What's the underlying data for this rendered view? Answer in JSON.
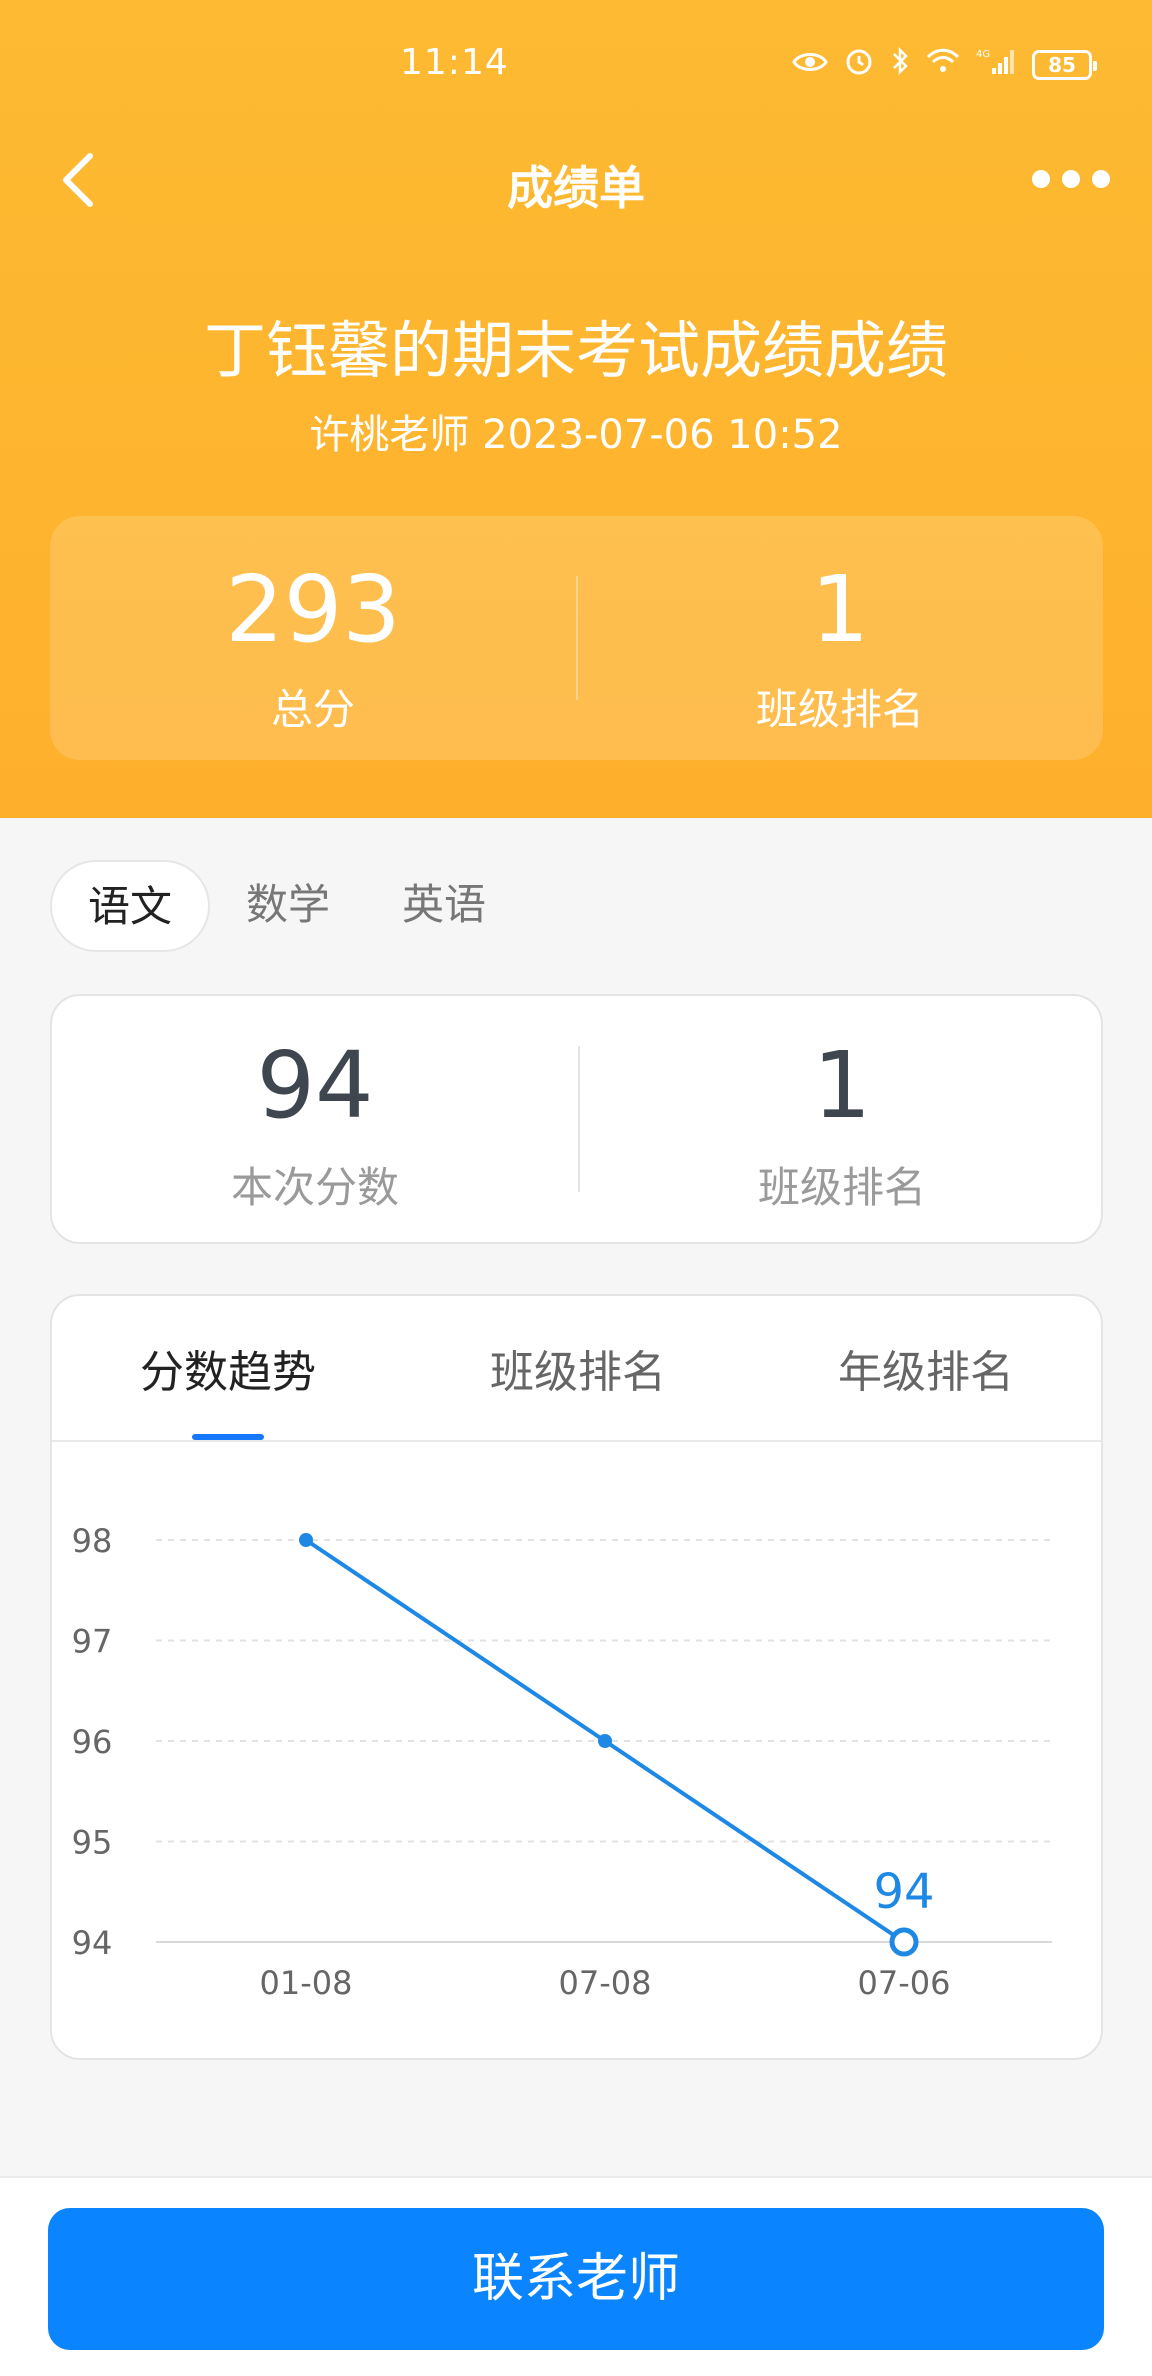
{
  "status_bar": {
    "time": "11:14",
    "network": "4G",
    "battery": "85"
  },
  "nav": {
    "title": "成绩单"
  },
  "report": {
    "title": "丁钰馨的期末考试成绩成绩",
    "subtitle": "许桃老师 2023-07-06 10:52"
  },
  "summary": {
    "total_score": "293",
    "total_label": "总分",
    "class_rank": "1",
    "rank_label": "班级排名"
  },
  "subjects": {
    "tabs": [
      "语文",
      "数学",
      "英语"
    ],
    "active": 0
  },
  "subject_score": {
    "score": "94",
    "score_label": "本次分数",
    "rank": "1",
    "rank_label": "班级排名"
  },
  "chart_tabs": {
    "items": [
      "分数趋势",
      "班级排名",
      "年级排名"
    ],
    "active": 0
  },
  "chart_data": {
    "type": "line",
    "categories": [
      "01-08",
      "07-08",
      "07-06"
    ],
    "series": [
      {
        "values": [
          98,
          96,
          94
        ]
      }
    ],
    "ylim": [
      94,
      98
    ],
    "yticks": [
      94,
      95,
      96,
      97,
      98
    ],
    "grid": true,
    "highlight_label": "94",
    "line_color": "#1e88e5"
  },
  "bottom": {
    "button_label": "联系老师"
  },
  "colors": {
    "header": "#FDB62F",
    "primary": "#0a84ff"
  }
}
